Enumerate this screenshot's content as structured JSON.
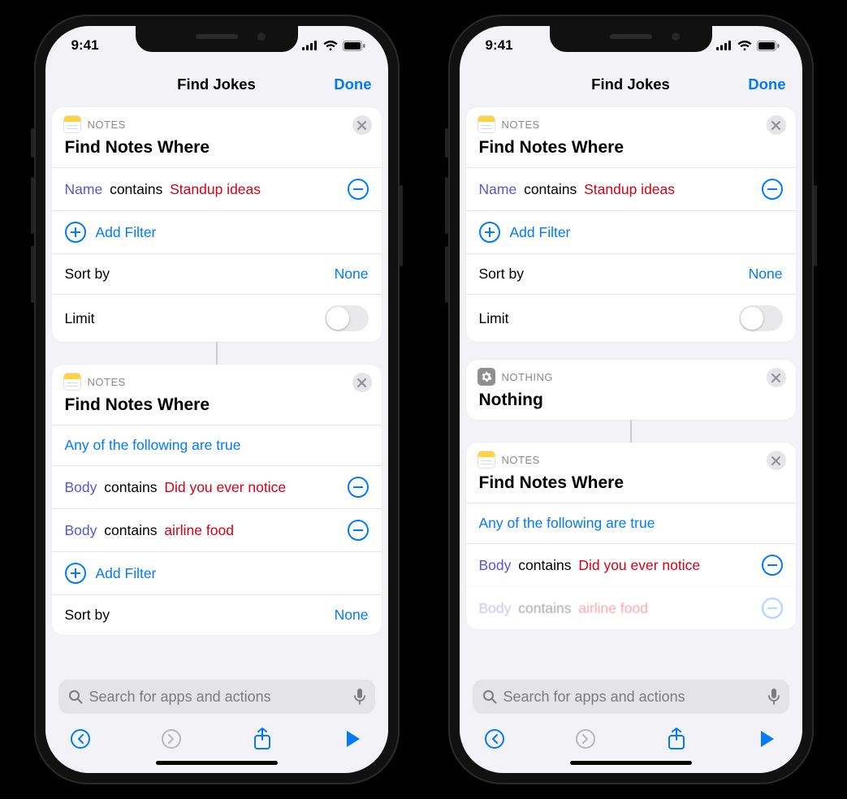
{
  "status": {
    "time": "9:41"
  },
  "nav": {
    "title": "Find Jokes",
    "done": "Done"
  },
  "labels": {
    "notes_app": "NOTES",
    "nothing_app": "NOTHING",
    "find_notes_where": "Find Notes Where",
    "nothing_title": "Nothing",
    "add_filter": "Add Filter",
    "sort_by": "Sort by",
    "none": "None",
    "limit": "Limit",
    "any_true": "Any of the following are true"
  },
  "filters": {
    "name_field": "Name",
    "body_field": "Body",
    "contains": "contains",
    "standup": "Standup ideas",
    "did_you": "Did you ever notice",
    "airline": "airline food"
  },
  "search": {
    "placeholder": "Search for apps and actions"
  }
}
